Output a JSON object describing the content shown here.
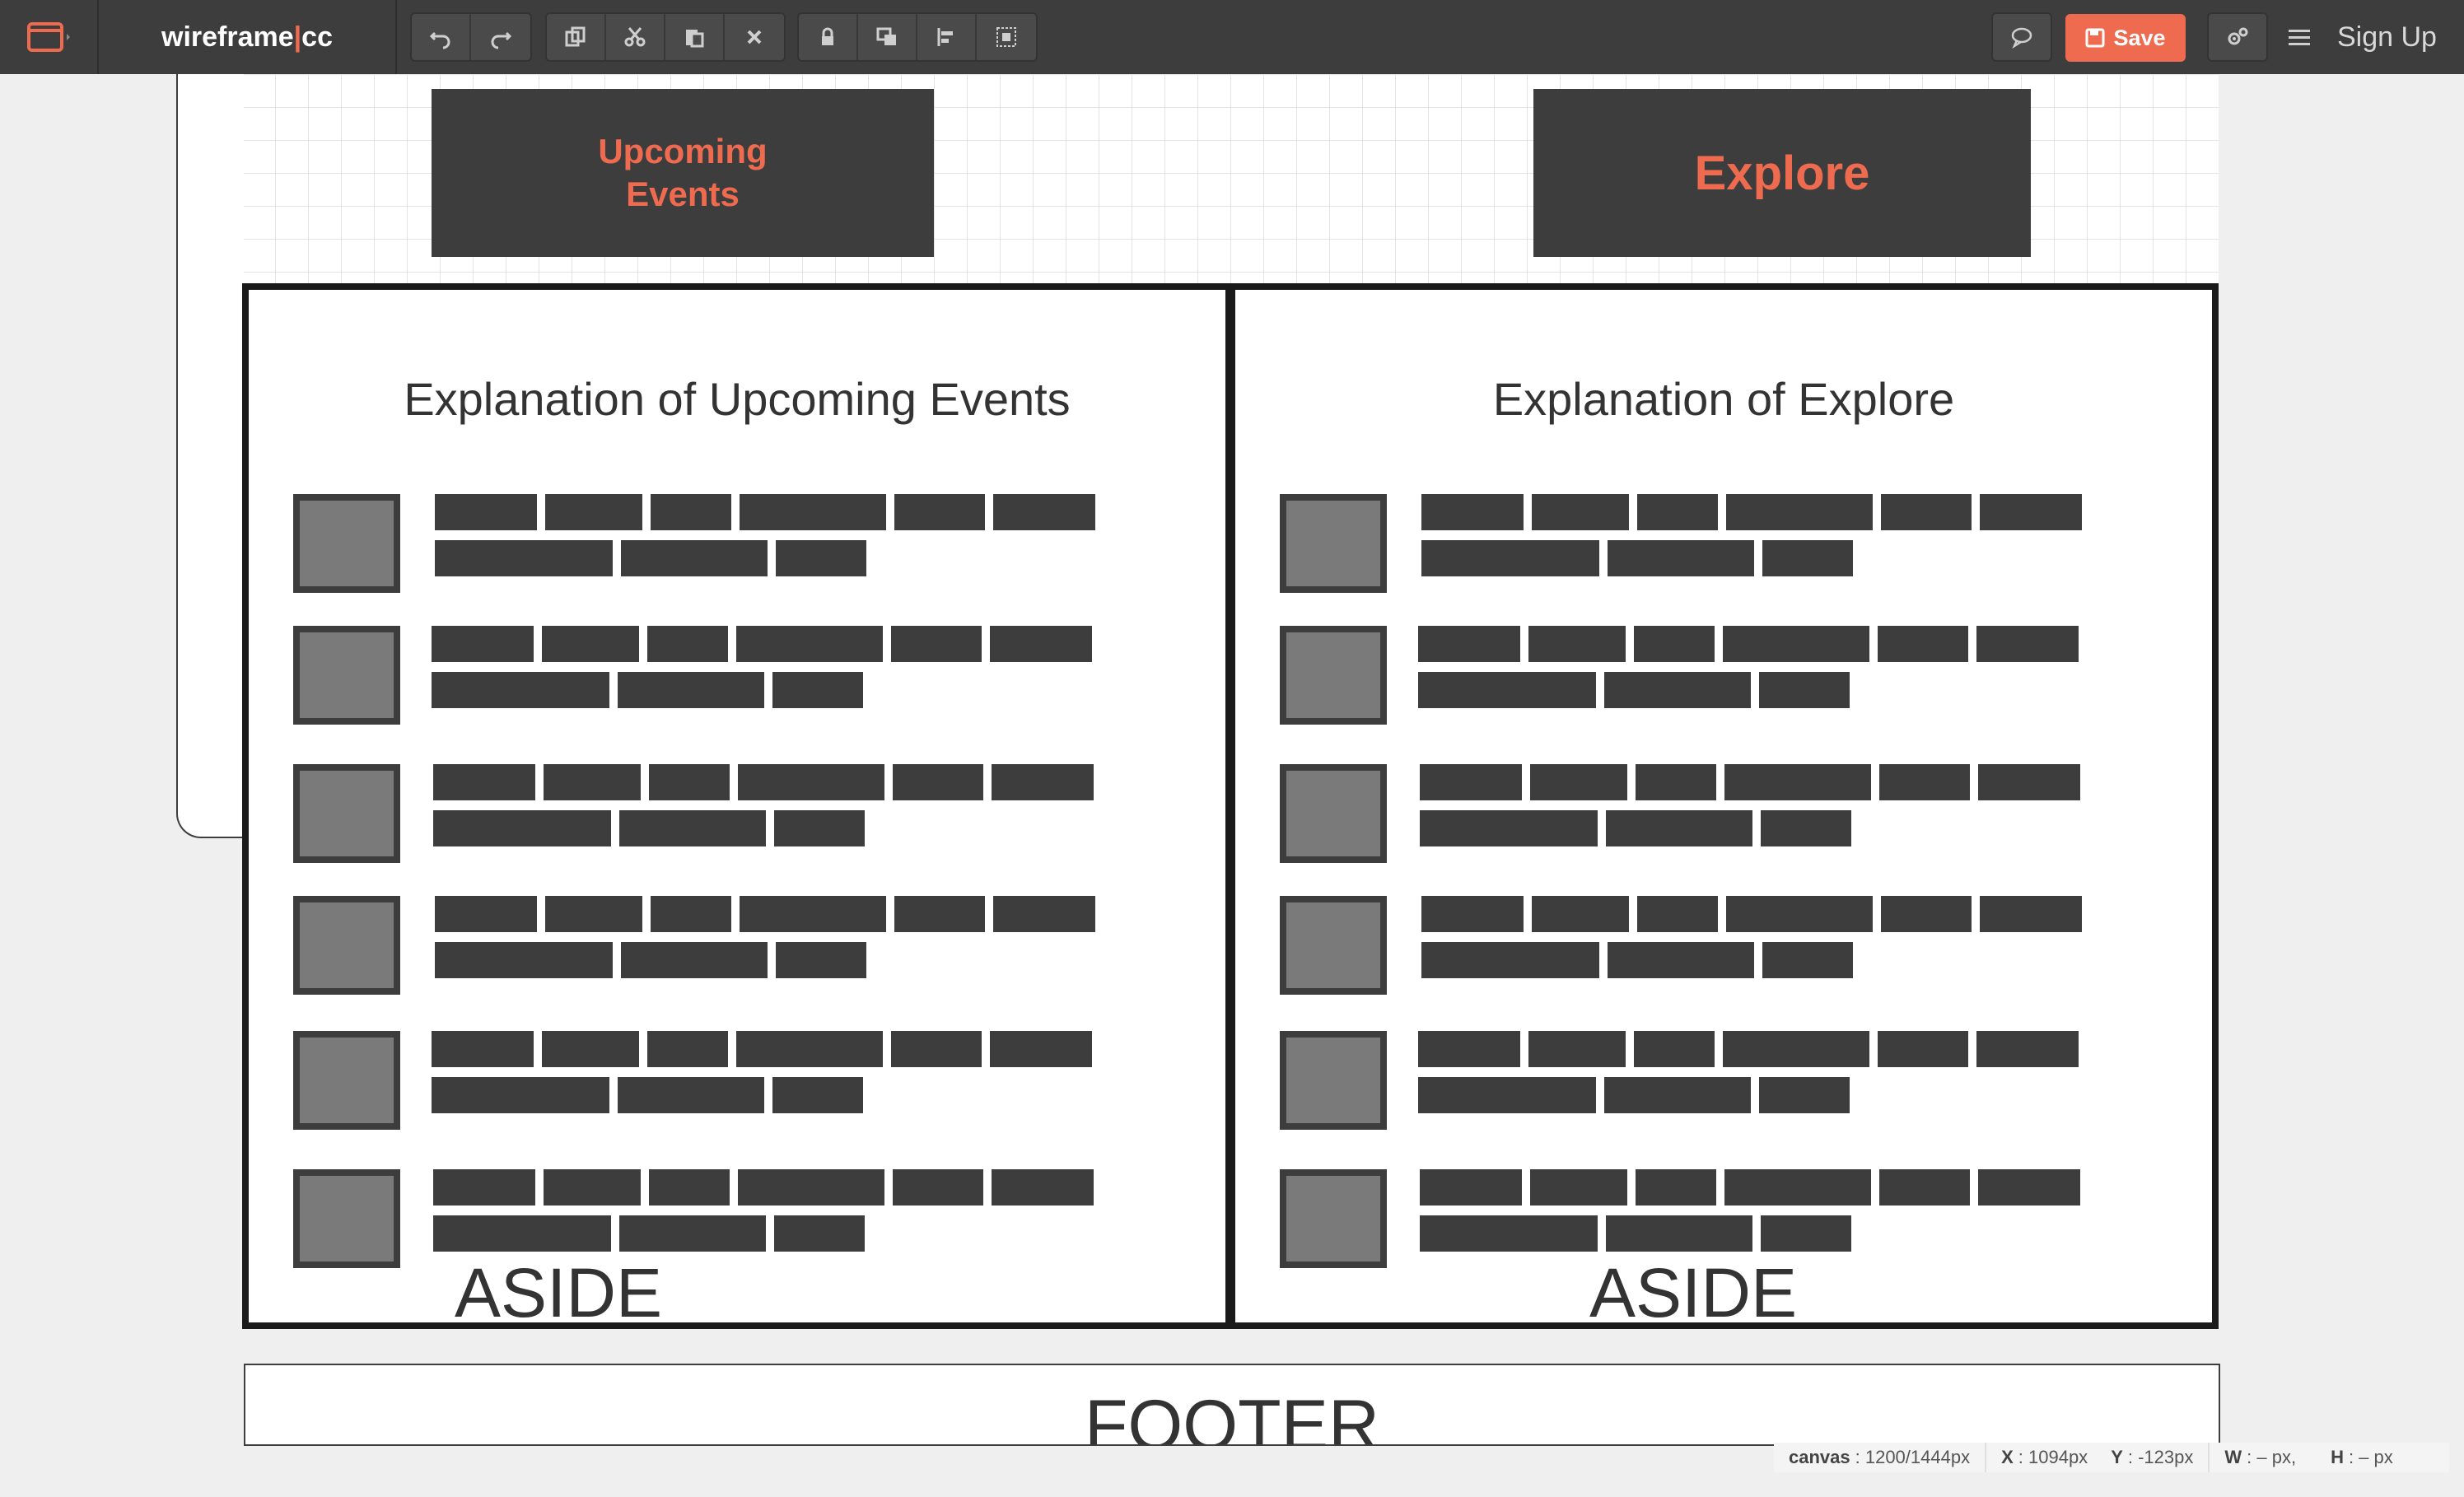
{
  "app": {
    "brand_left": "wireframe",
    "brand_sep": "|",
    "brand_right": "cc"
  },
  "toolbar": {
    "undo_icon": "undo-icon",
    "redo_icon": "redo-icon",
    "save_label": "Save",
    "signup_label": "Sign Up"
  },
  "canvas": {
    "nav_upcoming_line1": "Upcoming",
    "nav_upcoming_line2": "Events",
    "nav_explore": "Explore",
    "left_title": "Explanation of Upcoming Events",
    "right_title": "Explanation of Explore",
    "left_aside": "ASIDE",
    "right_aside": "ASIDE",
    "footer": "FOOTER"
  },
  "status": {
    "canvas_key": "canvas",
    "canvas_val": ": 1200/1444px",
    "x_key": "X",
    "x_val": ": 1094px",
    "y_key": "Y",
    "y_val": ": -123px",
    "w_key": "W",
    "w_val": ": – px,",
    "h_key": "H",
    "h_val": ": – px"
  },
  "colors": {
    "accent": "#ef6b50",
    "toolbar_bg": "#3d3d3d",
    "block": "#3d3d3d",
    "thumb": "#7a7a7a"
  }
}
